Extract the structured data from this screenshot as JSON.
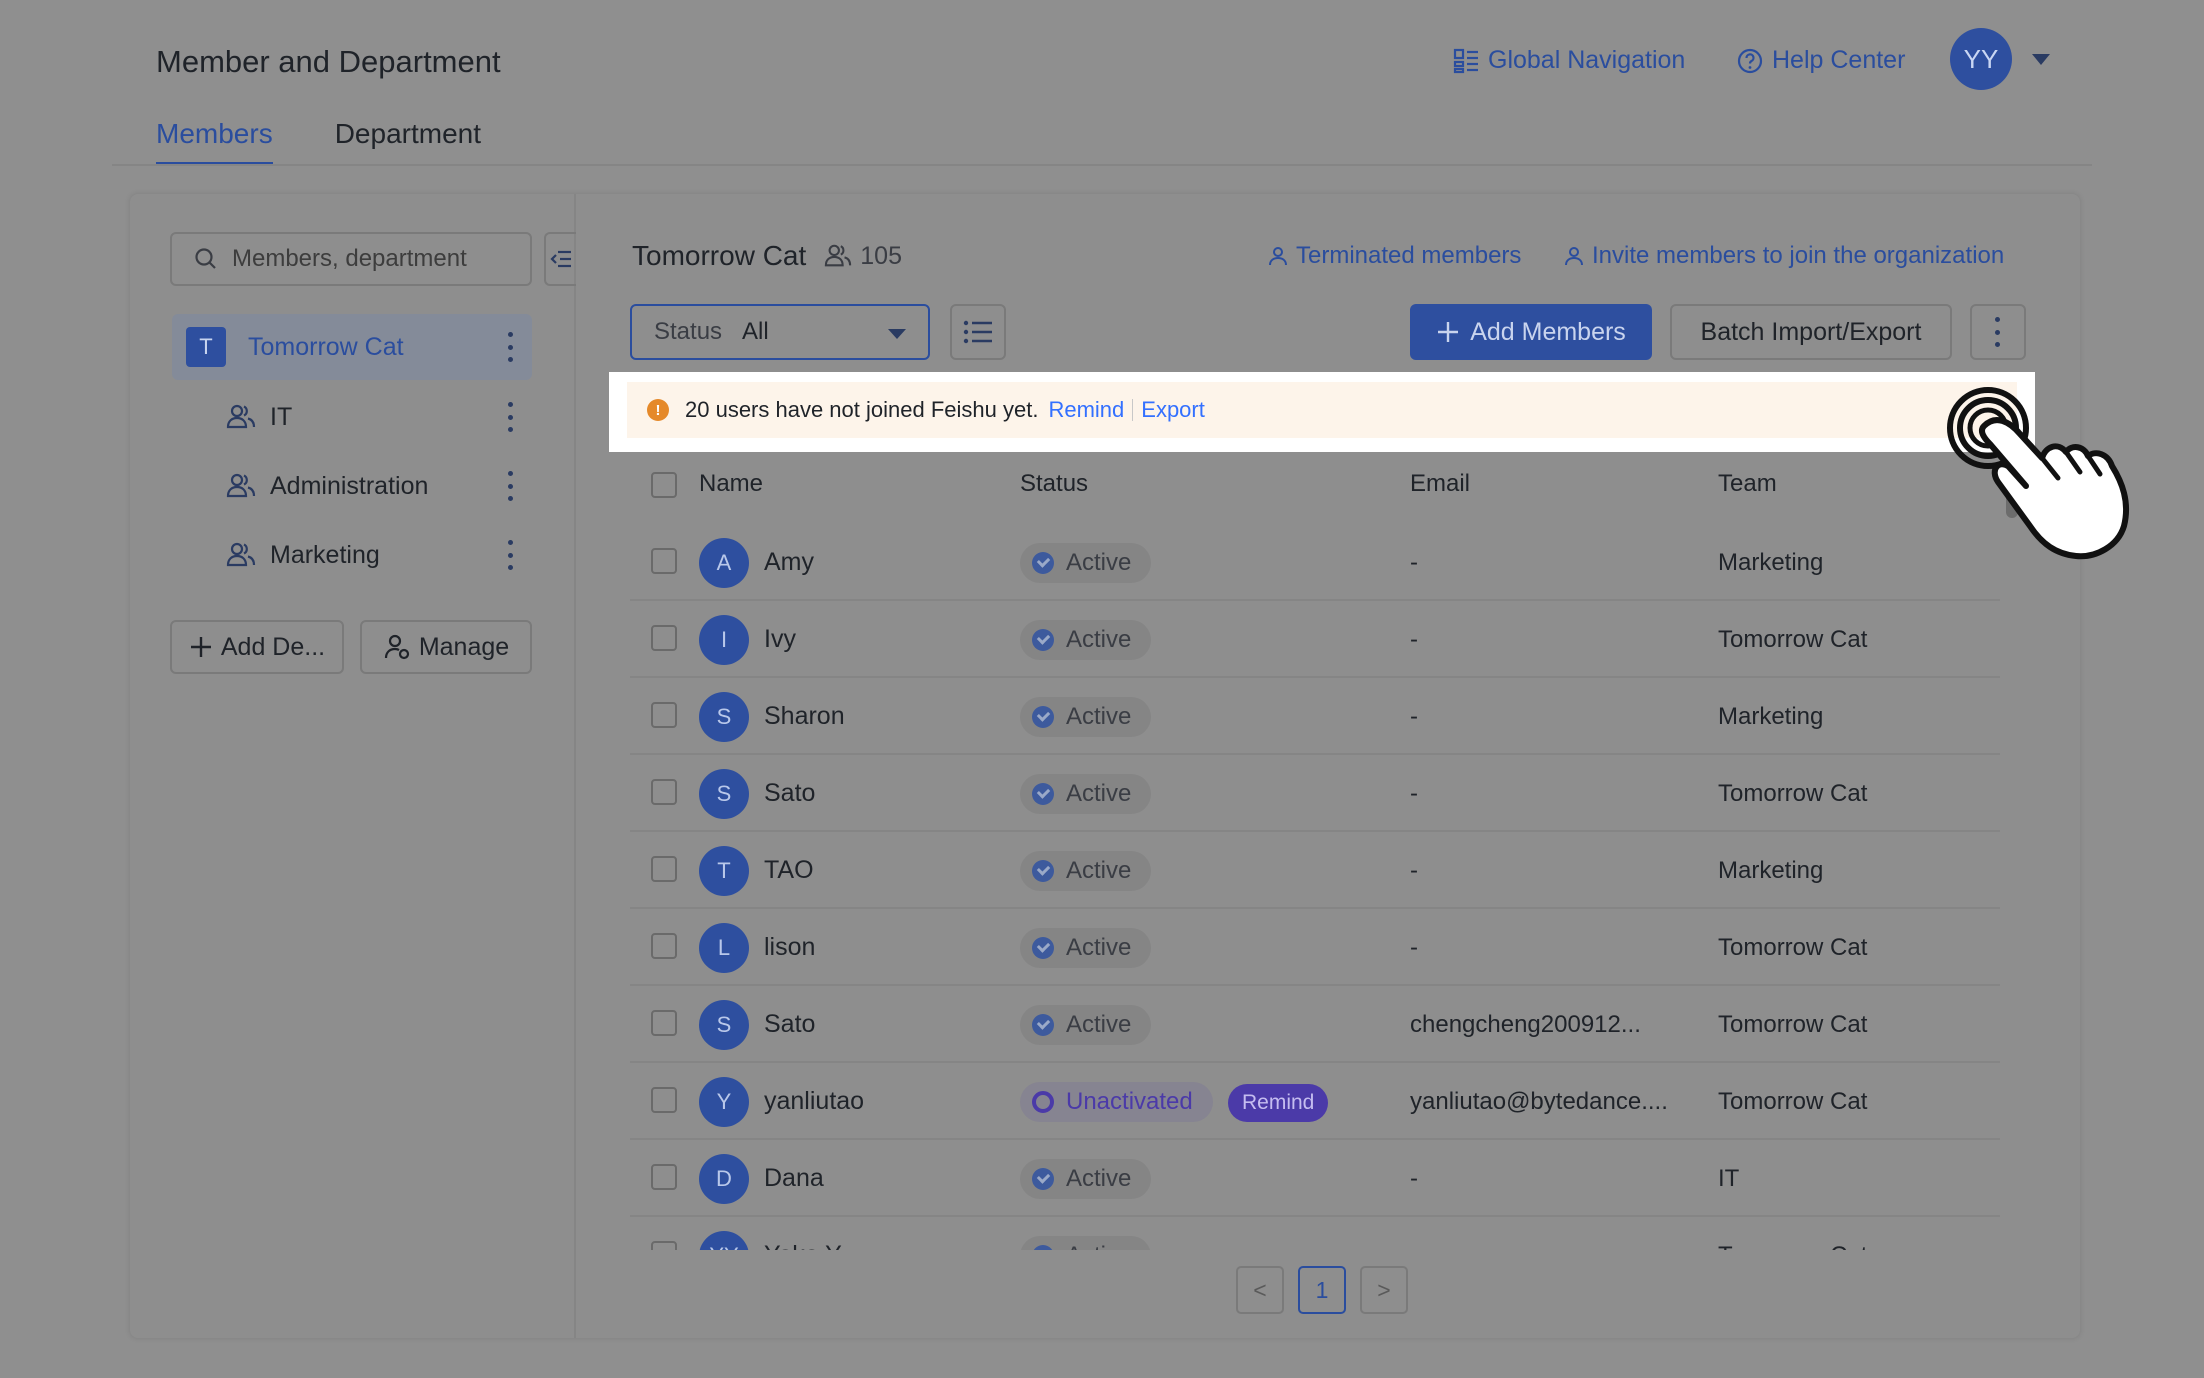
{
  "header": {
    "title": "Member and Department",
    "global_nav": "Global Navigation",
    "help_center": "Help Center",
    "avatar_initials": "YY"
  },
  "tabs": [
    {
      "label": "Members",
      "active": true
    },
    {
      "label": "Department",
      "active": false
    }
  ],
  "sidebar": {
    "search_placeholder": "Members, department",
    "root": {
      "badge": "T",
      "label": "Tomorrow Cat"
    },
    "departments": [
      {
        "label": "IT"
      },
      {
        "label": "Administration"
      },
      {
        "label": "Marketing"
      }
    ],
    "add_dept_label": "Add De...",
    "manage_label": "Manage"
  },
  "content": {
    "org_name": "Tomorrow Cat",
    "member_count": "105",
    "terminated_link": "Terminated members",
    "invite_link": "Invite members to join the organization",
    "filter_label": "Status",
    "filter_value": "All",
    "add_members": "Add Members",
    "batch": "Batch Import/Export"
  },
  "banner": {
    "message": "20 users have not joined Feishu yet.",
    "remind": "Remind",
    "export": "Export"
  },
  "table": {
    "columns": {
      "name": "Name",
      "status": "Status",
      "email": "Email",
      "team": "Team"
    },
    "rows": [
      {
        "initial": "A",
        "name": "Amy",
        "status": "Active",
        "email": "-",
        "team": "Marketing"
      },
      {
        "initial": "I",
        "name": "Ivy",
        "status": "Active",
        "email": "-",
        "team": "Tomorrow Cat"
      },
      {
        "initial": "S",
        "name": "Sharon",
        "status": "Active",
        "email": "-",
        "team": "Marketing"
      },
      {
        "initial": "S",
        "name": "Sato",
        "status": "Active",
        "email": "-",
        "team": "Tomorrow Cat"
      },
      {
        "initial": "T",
        "name": "TAO",
        "status": "Active",
        "email": "-",
        "team": "Marketing"
      },
      {
        "initial": "L",
        "name": "lison",
        "status": "Active",
        "email": "-",
        "team": "Tomorrow Cat"
      },
      {
        "initial": "S",
        "name": "Sato",
        "status": "Active",
        "email": "chengcheng200912...",
        "team": "Tomorrow Cat"
      },
      {
        "initial": "Y",
        "name": "yanliutao",
        "status": "Unactivated",
        "remind": "Remind",
        "email": "yanliutao@bytedance....",
        "team": "Tomorrow Cat"
      },
      {
        "initial": "D",
        "name": "Dana",
        "status": "Active",
        "email": "-",
        "team": "IT"
      },
      {
        "initial": "YY",
        "name": "Yoko Y",
        "status": "Active",
        "email": "-",
        "team": "Tomorrow Cat"
      }
    ]
  },
  "pagination": {
    "prev": "<",
    "current": "1",
    "next": ">"
  },
  "colors": {
    "accent": "#2e4f9f",
    "link": "#3370ff",
    "warning": "#e5892a",
    "unactivated": "#4b3aa8"
  },
  "icons": [
    "search-icon",
    "collapse-icon",
    "group-icon",
    "kebab-icon",
    "plus-icon",
    "user-manage-icon",
    "user-icon",
    "list-icon",
    "warning-icon",
    "check-icon",
    "hand-pointer-icon",
    "grid-icon",
    "help-icon"
  ]
}
